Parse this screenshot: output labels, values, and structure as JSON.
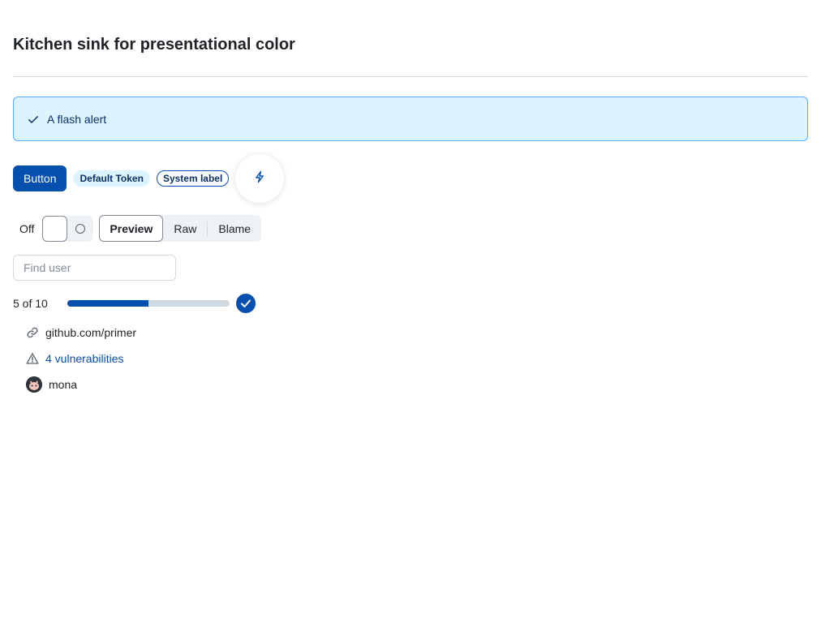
{
  "page": {
    "title": "Kitchen sink for presentational color"
  },
  "flash": {
    "icon": "check-icon",
    "text": "A flash alert"
  },
  "actions": {
    "button_label": "Button",
    "token_label": "Default Token",
    "system_label": "System label",
    "icon_button_icon": "zap-icon"
  },
  "toggle": {
    "state_text": "Off",
    "checked": false
  },
  "segmented": {
    "items": [
      {
        "label": "Preview",
        "selected": true
      },
      {
        "label": "Raw",
        "selected": false
      },
      {
        "label": "Blame",
        "selected": false
      }
    ]
  },
  "search": {
    "placeholder": "Find user",
    "value": ""
  },
  "progress": {
    "text": "5 of 10",
    "value": 5,
    "max": 10,
    "complete_icon": "check-circle-fill-icon"
  },
  "list": {
    "items": [
      {
        "icon": "link-icon",
        "text": "github.com/primer"
      },
      {
        "icon": "alert-icon",
        "text": "4 vulnerabilities"
      },
      {
        "icon": "avatar",
        "text": "mona"
      }
    ]
  },
  "colors": {
    "accent": "#0550ae",
    "accent_subtle": "#ddf4ff",
    "accent_border": "#54aeff",
    "text": "#1f2328",
    "border": "#d1d9e0"
  }
}
